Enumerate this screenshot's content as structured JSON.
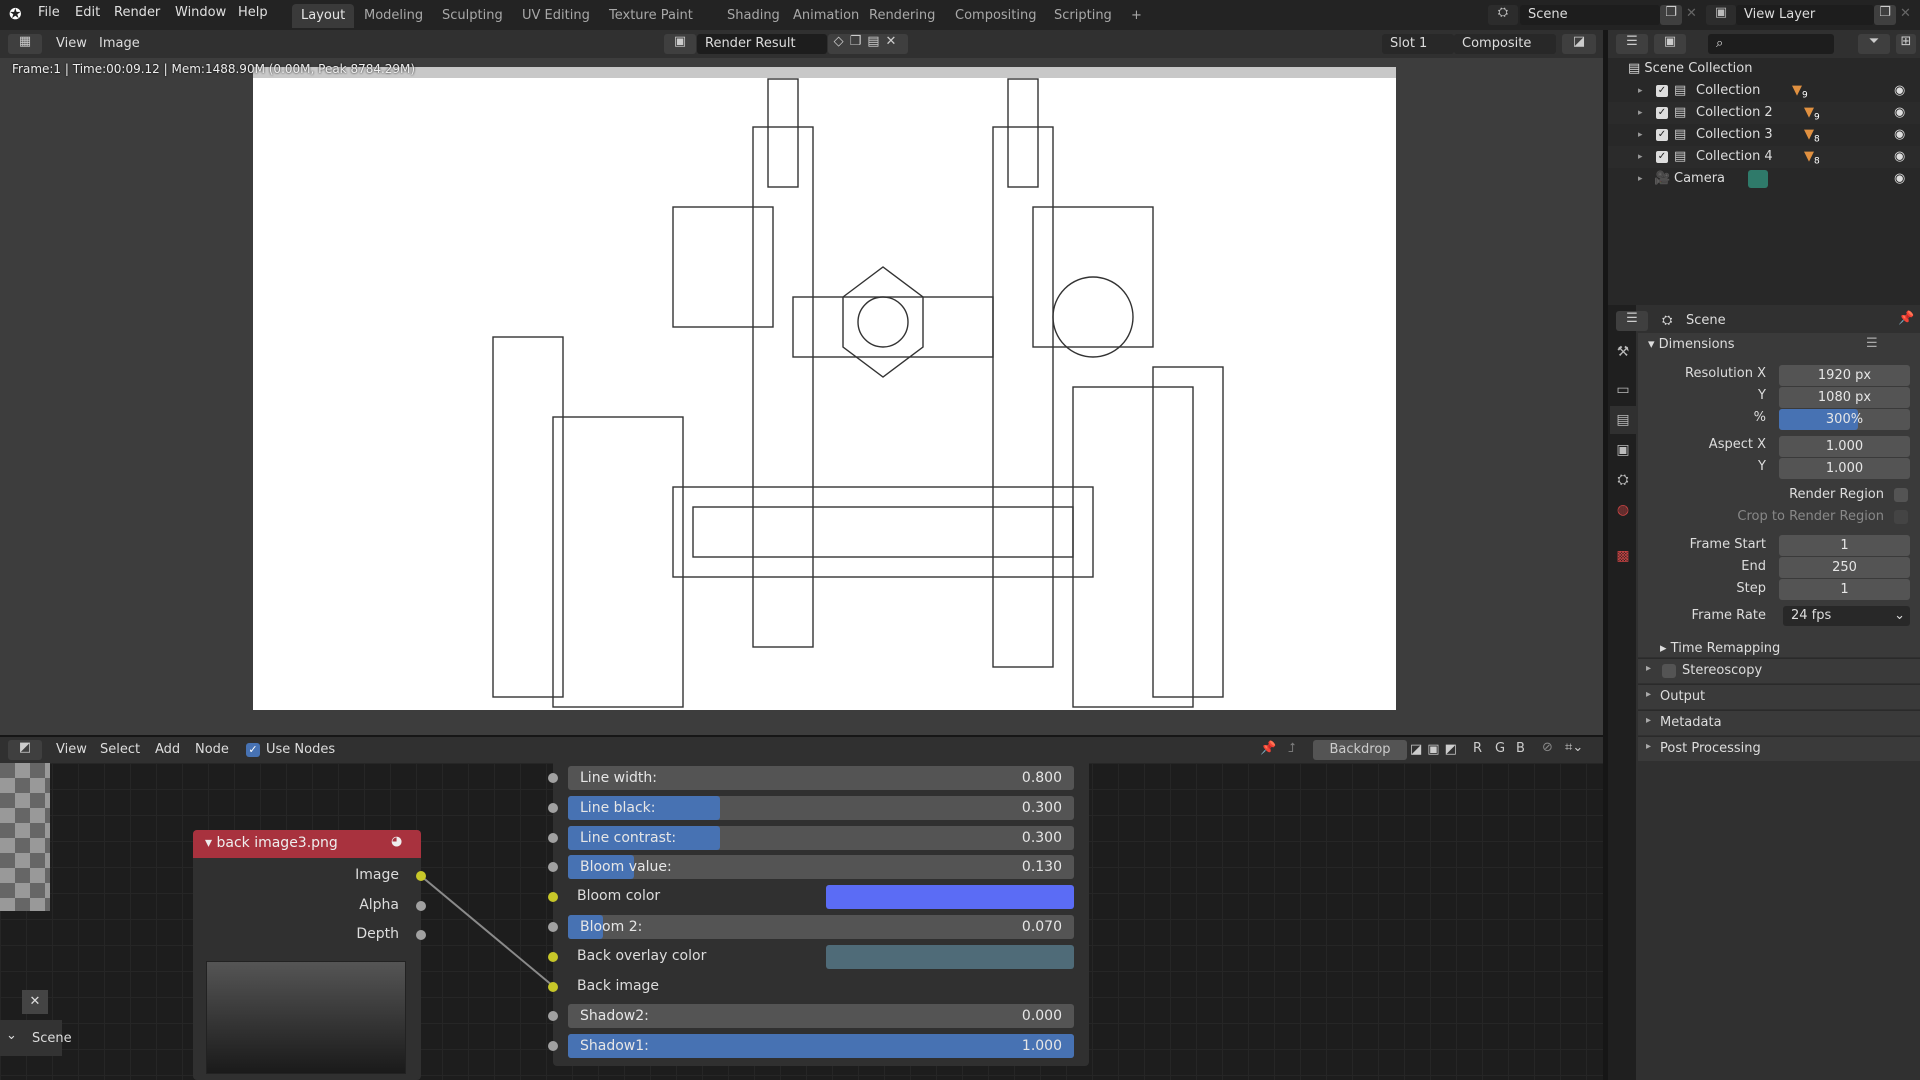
{
  "topbar": {
    "menus": [
      "File",
      "Edit",
      "Render",
      "Window",
      "Help"
    ],
    "workspaces": [
      "Layout",
      "Modeling",
      "Sculpting",
      "UV Editing",
      "Texture Paint",
      "Shading",
      "Animation",
      "Rendering",
      "Compositing",
      "Scripting"
    ],
    "add": "+",
    "scene": "Scene",
    "view_layer": "View Layer"
  },
  "image_editor": {
    "menus": [
      "View",
      "Image"
    ],
    "image_name": "Render Result",
    "slot": "Slot 1",
    "pass": "Composite",
    "status": "Frame:1 | Time:00:09.12 | Mem:1488.90M (0.00M, Peak 8784.29M)"
  },
  "outliner": {
    "root": "Scene Collection",
    "items": [
      {
        "label": "Collection",
        "count": "9"
      },
      {
        "label": "Collection 2",
        "count": "9"
      },
      {
        "label": "Collection 3",
        "count": "8"
      },
      {
        "label": "Collection 4",
        "count": "8"
      },
      {
        "label": "Camera",
        "count": ""
      }
    ]
  },
  "properties": {
    "context": "Scene",
    "panel": "Dimensions",
    "res_x_label": "Resolution X",
    "res_x": "1920 px",
    "res_y_label": "Y",
    "res_y": "1080 px",
    "pct_label": "%",
    "pct": "300%",
    "pct_fill": 0.6,
    "aspect_x_label": "Aspect X",
    "aspect_x": "1.000",
    "aspect_y_label": "Y",
    "aspect_y": "1.000",
    "render_region": "Render Region",
    "crop": "Crop to Render Region",
    "frame_start_label": "Frame Start",
    "frame_start": "1",
    "end_label": "End",
    "end": "250",
    "step_label": "Step",
    "step": "1",
    "frame_rate_label": "Frame Rate",
    "frame_rate": "24 fps",
    "time_remap": "Time Remapping",
    "sections": [
      "Stereoscopy",
      "Output",
      "Metadata",
      "Post Processing"
    ]
  },
  "node_editor": {
    "menus": [
      "View",
      "Select",
      "Add",
      "Node"
    ],
    "use_nodes": "Use Nodes",
    "backdrop": "Backdrop",
    "channels": [
      "R",
      "G",
      "B"
    ],
    "image_node": {
      "title": "back image3.png",
      "outputs": [
        "Image",
        "Alpha",
        "Depth"
      ]
    },
    "group_inputs": [
      {
        "label": "Line width:",
        "value": "0.800",
        "fill": 0
      },
      {
        "label": "Line black:",
        "value": "0.300",
        "fill": 0.3
      },
      {
        "label": "Line contrast:",
        "value": "0.300",
        "fill": 0.3
      },
      {
        "label": "Bloom value:",
        "value": "0.130",
        "fill": 0.13
      },
      {
        "label": "Bloom color",
        "color": "#5b6cf5"
      },
      {
        "label": "Bloom 2:",
        "value": "0.070",
        "fill": 0.07
      },
      {
        "label": "Back overlay color",
        "color": "#4f6b78"
      },
      {
        "label": "Back image"
      },
      {
        "label": "Shadow2:",
        "value": "0.000",
        "fill": 0
      },
      {
        "label": "Shadow1:",
        "value": "1.000",
        "fill": 1
      }
    ],
    "scene_label": "Scene"
  }
}
